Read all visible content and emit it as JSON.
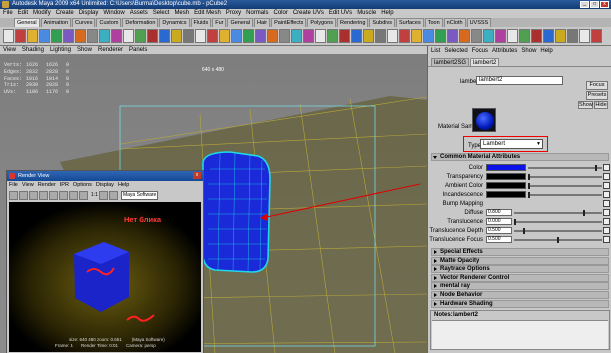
{
  "titlebar": {
    "text": "Autodesk Maya 2009 x64 Unlimited: C:\\Users\\Burma\\Desktop\\cube.mb  -  pCube2"
  },
  "menubar": [
    "File",
    "Edit",
    "Modify",
    "Create",
    "Display",
    "Window",
    "Assets",
    "Select",
    "Mesh",
    "Edit Mesh",
    "Proxy",
    "Normals",
    "Color",
    "Create UVs",
    "Edit UVs",
    "Muscle",
    "Help"
  ],
  "shelf_tabs": [
    "General",
    "Animation",
    "Curves",
    "Custom",
    "Deformation",
    "Dynamics",
    "Fluids",
    "Fur",
    "General",
    "Hair",
    "PaintEffects",
    "Polygons",
    "Rendering",
    "Subdivs",
    "Surfaces",
    "Toon",
    "nCloth",
    "UVSSS"
  ],
  "panel_menu": [
    "View",
    "Shading",
    "Lighting",
    "Show",
    "Renderer",
    "Panels"
  ],
  "stats": {
    "rows": [
      {
        "label": "Verts:",
        "a": "1626",
        "b": "1626",
        "c": "0"
      },
      {
        "label": "Edges:",
        "a": "2832",
        "b": "2828",
        "c": "0"
      },
      {
        "label": "Faces:",
        "a": "1016",
        "b": "1014",
        "c": "0"
      },
      {
        "label": "Tris:",
        "a": "2030",
        "b": "2028",
        "c": "0"
      },
      {
        "label": "UVs:",
        "a": "1106",
        "b": "1176",
        "c": "0"
      }
    ]
  },
  "viewport_resolution": "640 x 480",
  "render_view": {
    "title": "Render View",
    "menu": [
      "File",
      "View",
      "Render",
      "IPR",
      "Options",
      "Display",
      "Help"
    ],
    "ratio": "1:1",
    "mode": "Maya Software",
    "overlay_label": "Нет блика",
    "info_size": "size:  640  480  zoom: 0.651",
    "info_renderer": "(Maya Software)",
    "info_frame": "Frame: 1",
    "info_time": "Render Time: 0:01",
    "info_camera": "Camera: persp"
  },
  "attr": {
    "menu": [
      "List",
      "Selected",
      "Focus",
      "Attributes",
      "Show",
      "Help"
    ],
    "tabs": [
      "lambert2SG",
      "lambert2"
    ],
    "material_label": "lambert:",
    "material_name": "lambert2",
    "focus": "Focus",
    "presets": "Presets",
    "show": "Show",
    "hide": "Hide",
    "sample_label": "Material Sample",
    "type_label": "Type",
    "type_value": "Lambert",
    "common_section": "Common Material Attributes",
    "attrs": [
      {
        "label": "Color",
        "kind": "swatch",
        "color": "#0a12e8",
        "slider": 0.93
      },
      {
        "label": "Transparency",
        "kind": "swatch",
        "color": "#000000",
        "slider": 0.0
      },
      {
        "label": "Ambient Color",
        "kind": "swatch",
        "color": "#000000",
        "slider": 0.0
      },
      {
        "label": "Incandescence",
        "kind": "swatch",
        "color": "#000000",
        "slider": 0.0
      },
      {
        "label": "Bump Mapping",
        "kind": "blank"
      },
      {
        "label": "Diffuse",
        "kind": "value",
        "value": "0.800",
        "slider": 0.8
      },
      {
        "label": "Translucence",
        "kind": "value",
        "value": "0.000",
        "slider": 0.0
      },
      {
        "label": "Translucence Depth",
        "kind": "value",
        "value": "0.500",
        "slider": 0.1
      },
      {
        "label": "Translucence Focus",
        "kind": "value",
        "value": "0.500",
        "slider": 0.5
      }
    ],
    "sections": [
      "Special Effects",
      "Matte Opacity",
      "Raytrace Options",
      "Vector Renderer Control",
      "mental ray",
      "Node Behavior",
      "Hardware Shading"
    ],
    "notes_label": "Notes:",
    "notes_value": "lambert2"
  },
  "colors": {
    "title_bar": "#1a4a8a",
    "cube_wire": "#20d8e8",
    "cube_fill": "#1a2ad8",
    "arrow": "#e00000",
    "grid": "#b8a838"
  }
}
